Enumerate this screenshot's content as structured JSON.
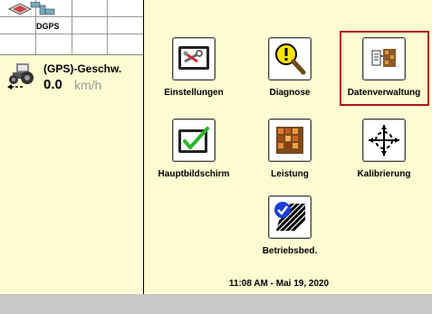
{
  "status_panel": {
    "gps_badge": "DGPS",
    "speed_label": "(GPS)-Geschw.",
    "speed_value": "0.0",
    "speed_unit": "km/h"
  },
  "menu": {
    "items": [
      {
        "label": "Einstellungen",
        "icon": "settings-icon"
      },
      {
        "label": "Diagnose",
        "icon": "diagnose-icon"
      },
      {
        "label": "Datenverwaltung",
        "icon": "data-management-icon",
        "selected": true
      },
      {
        "label": "Hauptbildschirm",
        "icon": "main-screen-icon"
      },
      {
        "label": "Leistung",
        "icon": "performance-icon"
      },
      {
        "label": "Kalibrierung",
        "icon": "calibration-icon"
      },
      {
        "label": "Betriebsbed.",
        "icon": "operating-conditions-icon"
      }
    ]
  },
  "footer": {
    "datetime": "11:08 AM - Mai 19, 2020"
  },
  "colors": {
    "background": "#fdfbd1",
    "highlight": "#b01515",
    "check": "#2bb52b"
  }
}
